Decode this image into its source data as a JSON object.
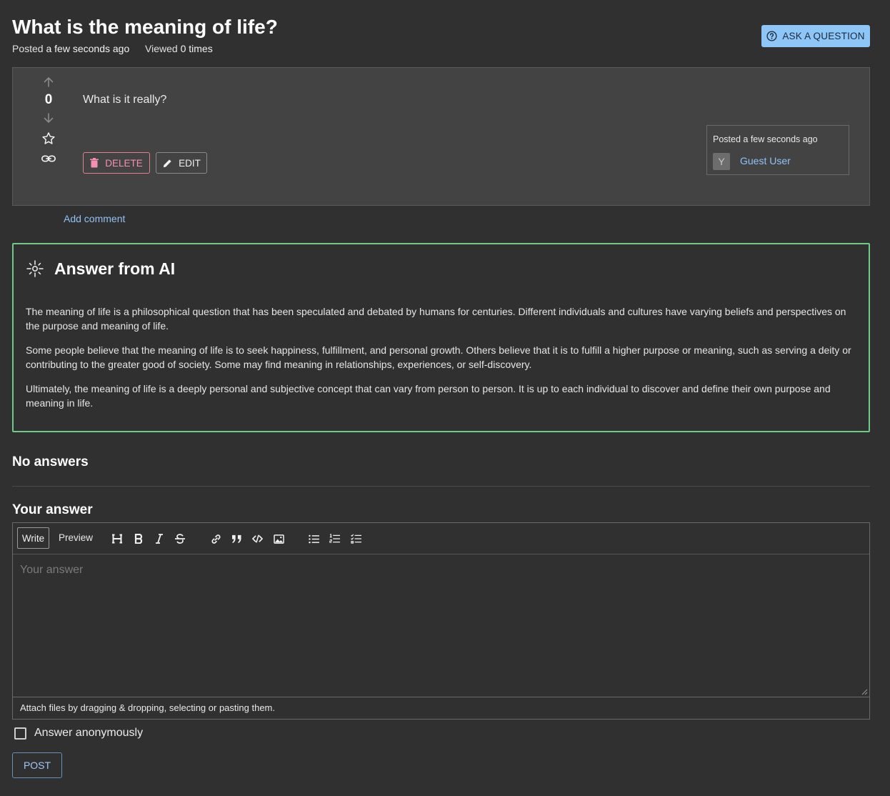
{
  "question": {
    "title": "What is the meaning of life?",
    "posted_label": "Posted",
    "posted_value": "a few seconds ago",
    "viewed_label": "Viewed",
    "viewed_value": "0 times",
    "body": "What is it really?",
    "score": "0"
  },
  "header": {
    "ask_button": "ASK A QUESTION"
  },
  "actions": {
    "delete_label": "DELETE",
    "edit_label": "EDIT"
  },
  "author": {
    "posted_text": "Posted a few seconds ago",
    "avatar_letter": "Y",
    "name": "Guest User"
  },
  "comments": {
    "add_label": "Add comment"
  },
  "ai_answer": {
    "heading": "Answer from AI",
    "paragraphs": [
      "The meaning of life is a philosophical question that has been speculated and debated by humans for centuries. Different individuals and cultures have varying beliefs and perspectives on the purpose and meaning of life.",
      "Some people believe that the meaning of life is to seek happiness, fulfillment, and personal growth. Others believe that it is to fulfill a higher purpose or meaning, such as serving a deity or contributing to the greater good of society. Some may find meaning in relationships, experiences, or self-discovery.",
      "Ultimately, the meaning of life is a deeply personal and subjective concept that can vary from person to person. It is up to each individual to discover and define their own purpose and meaning in life."
    ]
  },
  "answers": {
    "none_label": "No answers"
  },
  "answer_form": {
    "heading": "Your answer",
    "tab_write": "Write",
    "tab_preview": "Preview",
    "toolbar_icons": [
      "heading-icon",
      "bold-icon",
      "italic-icon",
      "strikethrough-icon",
      "link-icon",
      "quote-icon",
      "code-icon",
      "image-icon",
      "bulleted-list-icon",
      "numbered-list-icon",
      "task-list-icon"
    ],
    "placeholder": "Your answer",
    "attach_hint": "Attach files by dragging & dropping, selecting or pasting them.",
    "anonymous_label": "Answer anonymously",
    "anonymous_checked": false,
    "post_button": "POST"
  },
  "colors": {
    "background": "#303030",
    "card": "#434343",
    "accent_blue": "#90c2f5",
    "ask_button_bg": "#8fc6f8",
    "delete_pink": "#f48fb1",
    "ai_border_green": "#6fc987"
  }
}
